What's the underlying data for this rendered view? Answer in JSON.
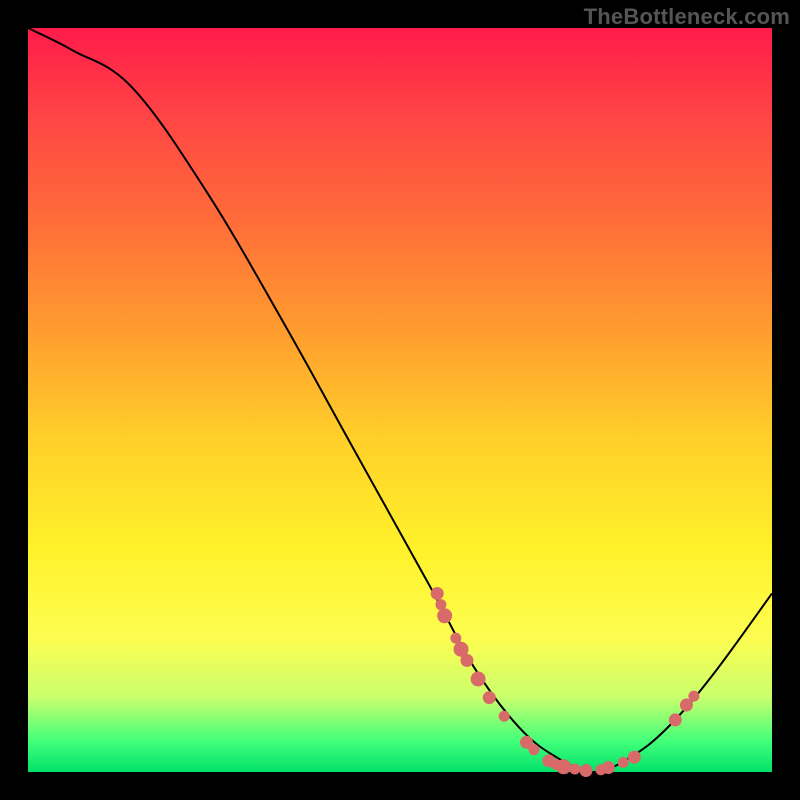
{
  "watermark": "TheBottleneck.com",
  "chart_data": {
    "type": "line",
    "title": "",
    "xlabel": "",
    "ylabel": "",
    "xlim": [
      0,
      100
    ],
    "ylim": [
      0,
      100
    ],
    "curve": [
      {
        "x": 0,
        "y": 100
      },
      {
        "x": 6,
        "y": 97
      },
      {
        "x": 14,
        "y": 92
      },
      {
        "x": 24,
        "y": 78
      },
      {
        "x": 34,
        "y": 61
      },
      {
        "x": 44,
        "y": 43
      },
      {
        "x": 54,
        "y": 25
      },
      {
        "x": 60,
        "y": 14
      },
      {
        "x": 66,
        "y": 6
      },
      {
        "x": 71,
        "y": 2
      },
      {
        "x": 76,
        "y": 0
      },
      {
        "x": 81,
        "y": 2
      },
      {
        "x": 86,
        "y": 6
      },
      {
        "x": 92,
        "y": 13
      },
      {
        "x": 100,
        "y": 24
      }
    ],
    "markers": [
      {
        "x": 55,
        "y": 24,
        "r": 6
      },
      {
        "x": 55.5,
        "y": 22.5,
        "r": 5
      },
      {
        "x": 56,
        "y": 21,
        "r": 7
      },
      {
        "x": 57.5,
        "y": 18,
        "r": 5
      },
      {
        "x": 58.2,
        "y": 16.5,
        "r": 7
      },
      {
        "x": 59,
        "y": 15,
        "r": 6
      },
      {
        "x": 60.5,
        "y": 12.5,
        "r": 7
      },
      {
        "x": 62,
        "y": 10,
        "r": 6
      },
      {
        "x": 64,
        "y": 7.5,
        "r": 5
      },
      {
        "x": 67,
        "y": 4,
        "r": 6
      },
      {
        "x": 68,
        "y": 3,
        "r": 5
      },
      {
        "x": 70,
        "y": 1.5,
        "r": 6
      },
      {
        "x": 71,
        "y": 1,
        "r": 5
      },
      {
        "x": 72,
        "y": 0.7,
        "r": 7
      },
      {
        "x": 73.5,
        "y": 0.4,
        "r": 5
      },
      {
        "x": 75,
        "y": 0.2,
        "r": 6
      },
      {
        "x": 77,
        "y": 0.3,
        "r": 5
      },
      {
        "x": 78,
        "y": 0.6,
        "r": 6
      },
      {
        "x": 80,
        "y": 1.3,
        "r": 5
      },
      {
        "x": 81.5,
        "y": 2,
        "r": 6
      },
      {
        "x": 87,
        "y": 7,
        "r": 6
      },
      {
        "x": 88.5,
        "y": 9,
        "r": 6
      },
      {
        "x": 89.5,
        "y": 10.2,
        "r": 5
      }
    ]
  }
}
